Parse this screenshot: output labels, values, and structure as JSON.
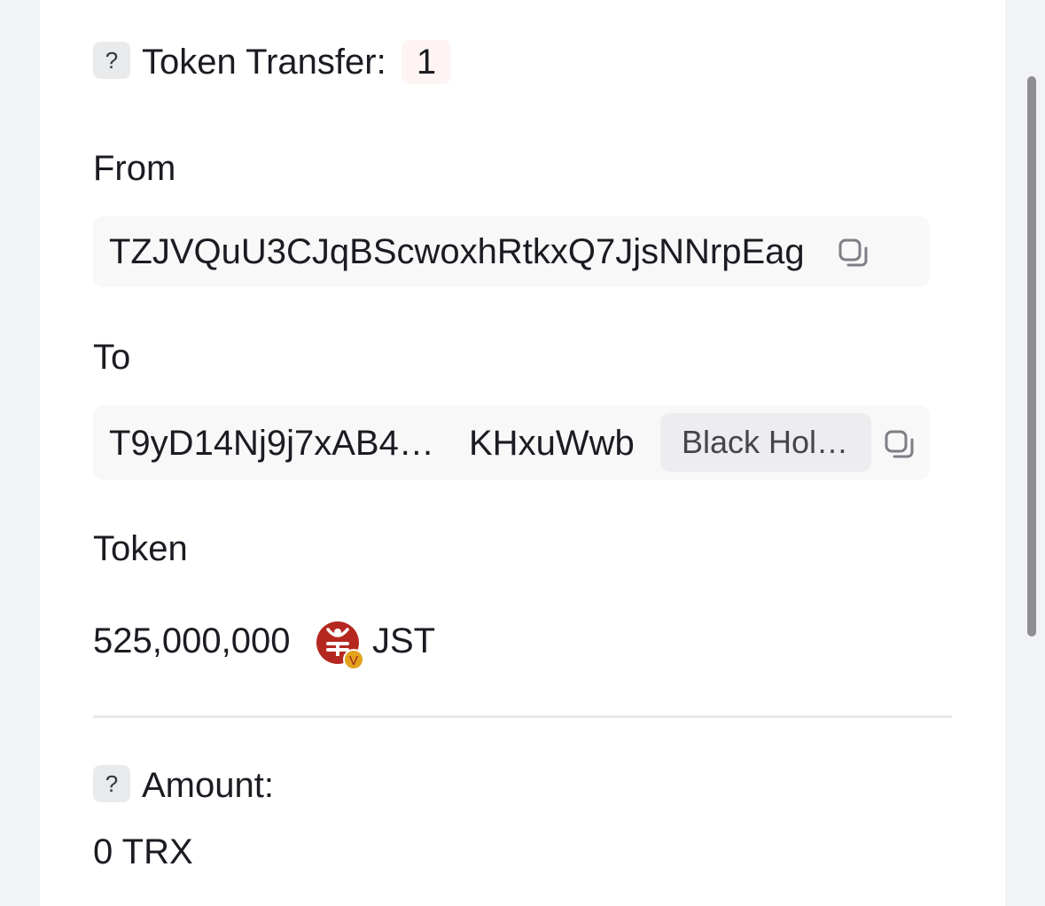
{
  "token_transfer": {
    "help_glyph": "?",
    "title": "Token Transfer:",
    "count": "1"
  },
  "from": {
    "label": "From",
    "address": "TZJVQuU3CJqBScwoxhRtkxQ7JjsNNrpEag",
    "copy_icon": "copy-icon"
  },
  "to": {
    "label": "To",
    "address_start": "T9yD14Nj9j7xAB4…",
    "address_end": "KHxuWwb",
    "tag": "Black Hol…",
    "copy_icon": "copy-icon"
  },
  "token": {
    "label": "Token",
    "amount": "525,000,000",
    "logo_icon": "jst-token-logo",
    "verified_badge": "V",
    "symbol": "JST"
  },
  "amount": {
    "help_glyph": "?",
    "label": "Amount:",
    "value": "0 TRX"
  },
  "colors": {
    "token_logo": "#b5281f",
    "verified_badge": "#e2a21a",
    "scrollbar": "#8e8e93"
  }
}
